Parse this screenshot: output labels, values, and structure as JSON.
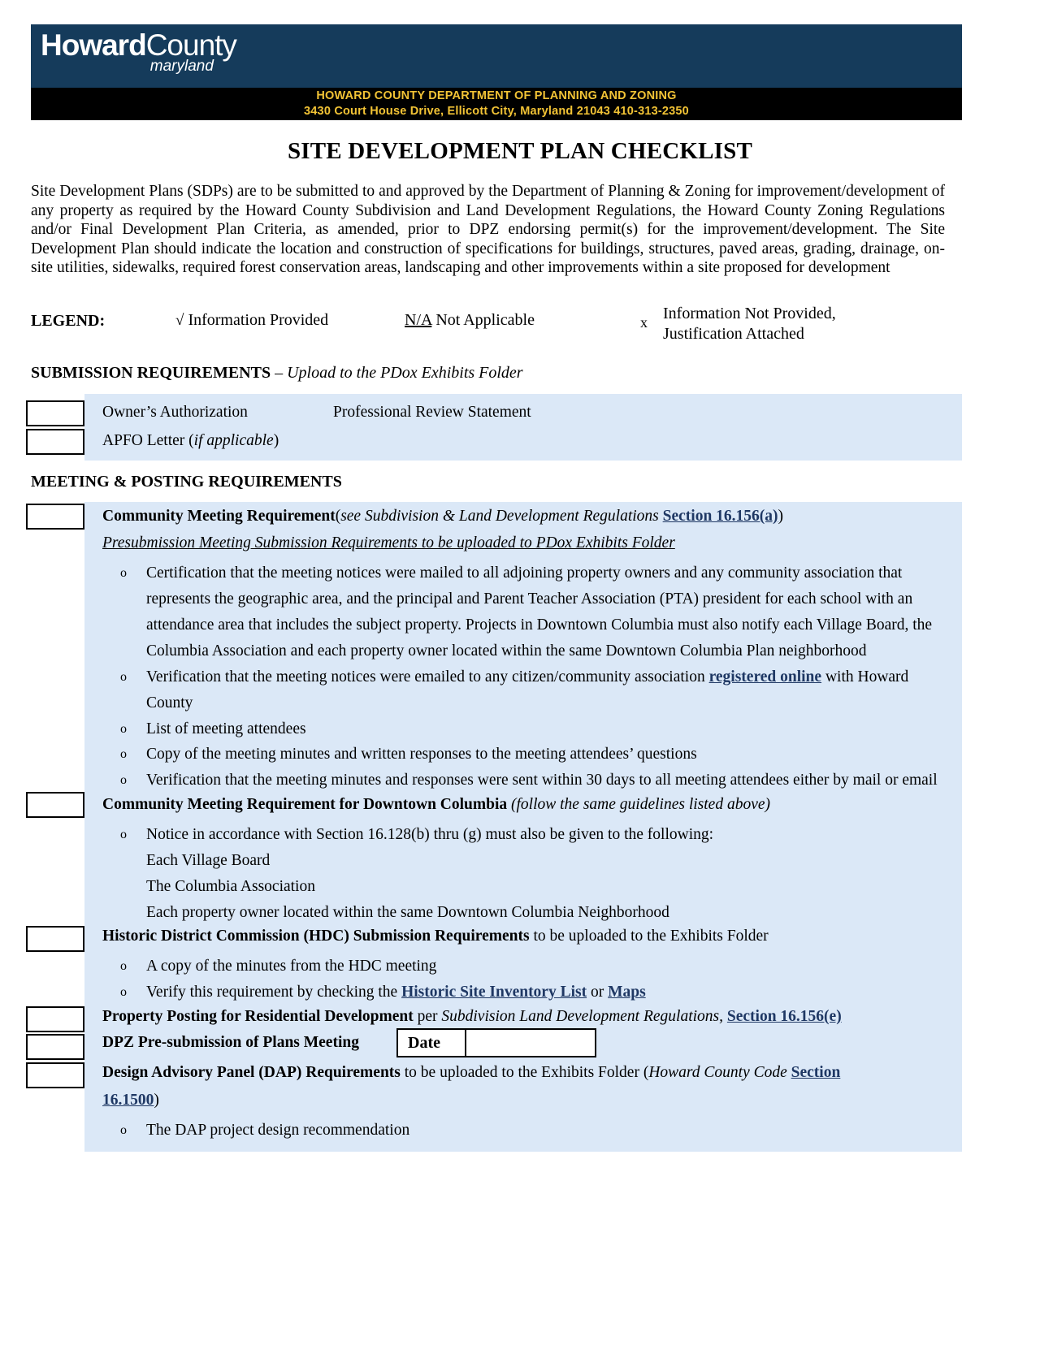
{
  "header": {
    "logo_bold": "Howard",
    "logo_thin": "County",
    "logo_sub": "maryland",
    "dept_line1": "HOWARD COUNTY DEPARTMENT OF PLANNING AND ZONING",
    "dept_line2": "3430 Court House Drive, Ellicott City, Maryland 21043 410-313-2350",
    "brand_blue": "#153b5b",
    "brand_gold": "#f2c335"
  },
  "title": "SITE DEVELOPMENT PLAN CHECKLIST",
  "intro": "Site Development Plans (SDPs) are to be submitted to and approved by the Department of Planning & Zoning for improvement/development of any property as required by the Howard County Subdivision and Land Development Regulations, the Howard County Zoning Regulations and/or Final Development Plan Criteria, as amended, prior to DPZ endorsing permit(s) for the improvement/development. The Site Development Plan should indicate the location and construction of specifications for buildings, structures, paved areas, grading, drainage, on-site utilities, sidewalks, required forest conservation areas, landscaping and other improvements within a site proposed for development",
  "legend": {
    "label": "LEGEND:",
    "item1_mark": "√",
    "item1_text": "Information Provided",
    "item2_mark": "N/A",
    "item2_text": "Not Applicable",
    "item3_mark": "x",
    "item3_line1": "Information Not Provided,",
    "item3_line2": "Justification Attached"
  },
  "submission": {
    "heading": "SUBMISSION REQUIREMENTS",
    "heading_italic": "– Upload to the PDox Exhibits Folder",
    "row1_a": "Owner’s Authorization",
    "row1_b": "Professional Review Statement",
    "row2_a": "APFO Letter (",
    "row2_ital": "if applicable",
    "row2_b": ")"
  },
  "meeting": {
    "heading": "MEETING & POSTING REQUIREMENTS",
    "community": {
      "title": "Community Meeting Requirement",
      "paren_open": "(",
      "paren_ital": "see Subdivision & Land Development Regulations ",
      "link": "Section 16.156(a)",
      "paren_close": ")",
      "subtitle": "Presubmission Meeting Submission Requirements to be uploaded to PDox Exhibits Folder",
      "bullets": [
        "Certification that the meeting notices were mailed to all adjoining property owners and any community association that represents the geographic area, and the principal and Parent Teacher Association (PTA) president for each school with an attendance area that includes the subject property. Projects in Downtown Columbia must also notify each Village Board, the Columbia Association and each property owner located within the same Downtown Columbia Plan neighborhood",
        "List of meeting attendees",
        "Copy of the meeting minutes and written responses to the meeting attendees’ questions",
        "Verification that the meeting minutes and responses were sent within 30 days to all meeting attendees either by mail or email"
      ],
      "bullet_email_pre": "Verification that the meeting notices were emailed to any citizen/community association ",
      "bullet_email_link": "registered online",
      "bullet_email_post": " with Howard County"
    },
    "downtown": {
      "title": "Community Meeting Requirement for Downtown Columbia",
      "paren": "(follow the same guidelines listed above)",
      "bullet": "Notice in accordance with Section 16.128(b) thru (g) must also be given to the following:",
      "subitems": [
        "Each Village Board",
        "The Columbia Association",
        "Each property owner located within the same Downtown Columbia Neighborhood"
      ]
    },
    "hdc": {
      "title": "Historic District Commission (HDC) Submission Requirements",
      "rest": " to be uploaded to the Exhibits Folder",
      "bullet1": "A copy of the minutes from the HDC meeting",
      "bullet2_pre": "Verify this requirement by checking the ",
      "bullet2_link1": "Historic Site Inventory List",
      "bullet2_mid": " or ",
      "bullet2_link2": "Maps"
    },
    "posting": {
      "title": "Property Posting for Residential Development",
      "mid": " per ",
      "ital": "Subdivision  Land Development Regulations,",
      "link": "Section 16.156(e)"
    },
    "dpz": {
      "title": "DPZ Pre-submission of Plans Meeting",
      "date_label": "Date",
      "date_value": ""
    },
    "dap": {
      "title": "Design Advisory Panel (DAP) Requirements",
      "mid": " to be uploaded to the Exhibits Folder (",
      "ital": "Howard County Code ",
      "link1": "Section",
      "link2": "16.1500",
      "close": ")",
      "bullet": "The DAP project design recommendation"
    }
  },
  "colors": {
    "panel_blue": "#dbe8f7",
    "link_navy": "#1f3864"
  }
}
